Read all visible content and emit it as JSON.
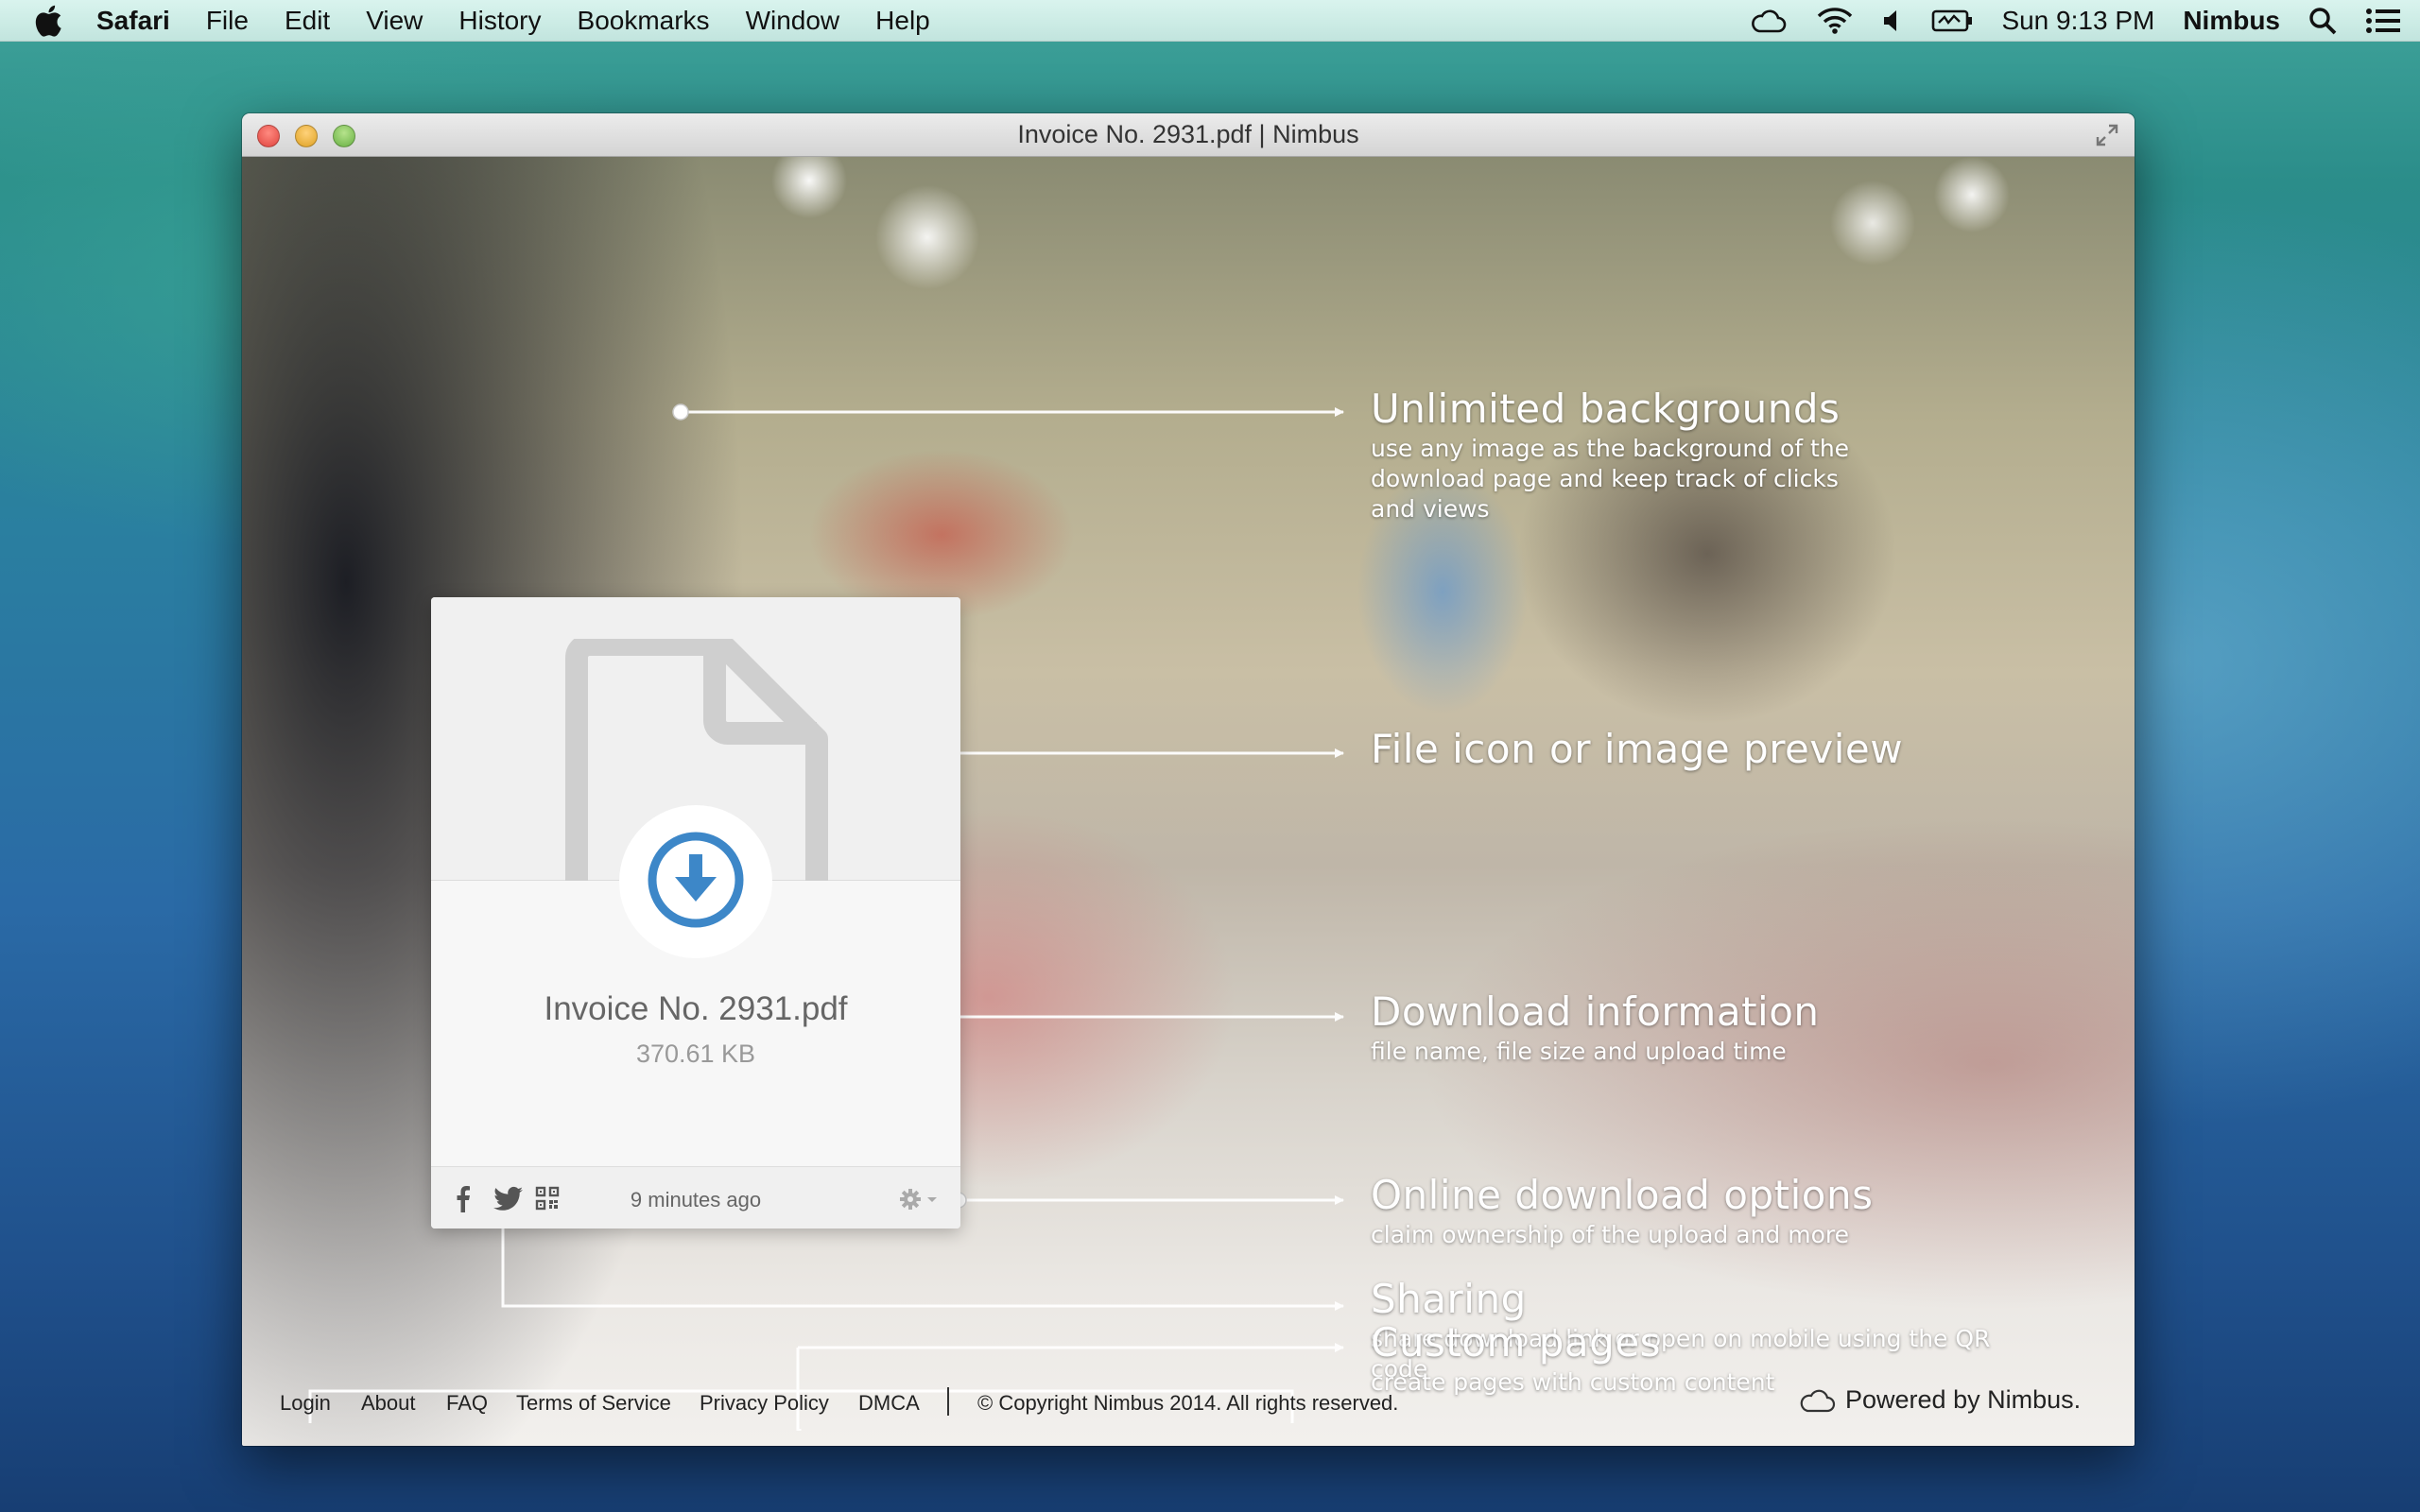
{
  "menubar": {
    "app_name": "Safari",
    "menus": [
      "File",
      "Edit",
      "View",
      "History",
      "Bookmarks",
      "Window",
      "Help"
    ],
    "clock": "Sun 9:13 PM",
    "user": "Nimbus",
    "icons": [
      "cloud-icon",
      "wifi-icon",
      "volume-icon",
      "battery-icon",
      "spotlight-icon",
      "notifications-icon"
    ]
  },
  "window": {
    "title": "Invoice No. 2931.pdf | Nimbus"
  },
  "card": {
    "file_name": "Invoice No. 2931.pdf",
    "file_size": "370.61 KB",
    "uploaded": "9 minutes ago",
    "accent_color": "#3d87c8"
  },
  "features": {
    "backgrounds": {
      "title": "Unlimited backgrounds",
      "desc1": "use any image as the background of the",
      "desc2": "download page and keep track of clicks",
      "desc3": "and views"
    },
    "preview": {
      "title": "File icon or image preview"
    },
    "download_info": {
      "title": "Download information",
      "desc1": "file name, file size and upload time"
    },
    "online_options": {
      "title": "Online download options",
      "desc1": "claim ownership of the upload and more"
    },
    "sharing": {
      "title": "Sharing",
      "desc1": "share download link or open on mobile using the QR",
      "desc2": "code"
    },
    "custom_pages": {
      "title": "Custom pages",
      "desc1": "create pages with custom content"
    }
  },
  "footer": {
    "links": [
      "Login",
      "About",
      "FAQ",
      "Terms of Service",
      "Privacy Policy",
      "DMCA"
    ],
    "copyright": "© Copyright Nimbus 2014. All rights reserved.",
    "powered_by": "Powered by Nimbus."
  }
}
